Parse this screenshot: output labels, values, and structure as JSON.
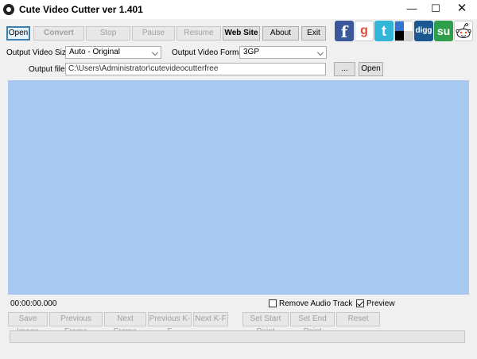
{
  "window": {
    "title": "Cute Video Cutter ver 1.401",
    "minimize_glyph": "—",
    "maximize_glyph": "☐",
    "close_glyph": "✕"
  },
  "toolbar": {
    "open": "Open",
    "convert": "Convert",
    "stop": "Stop",
    "pause": "Pause",
    "resume": "Resume",
    "website": "Web Site",
    "about": "About",
    "exit": "Exit"
  },
  "social": {
    "facebook": "f",
    "google": "g",
    "twitter": "t",
    "digg": "digg",
    "stumbleupon": "su"
  },
  "settings": {
    "video_size_label": "Output Video Size:",
    "video_size_value": "Auto - Original",
    "video_format_label": "Output Video Format:",
    "video_format_value": "3GP",
    "output_file_label": "Output file:",
    "output_file_value": "C:\\Users\\Administrator\\cutevideocutterfree",
    "browse": "...",
    "open_folder": "Open"
  },
  "status": {
    "time": "00:00:00.000",
    "remove_audio_label": "Remove Audio Track",
    "remove_audio_checked": false,
    "preview_label": "Preview",
    "preview_checked": true
  },
  "controls": {
    "save_image": "Save Image",
    "previous_frame": "Previous Frame",
    "next_frame": "Next Frame",
    "previous_kf": "Previous K-F",
    "next_kf": "Next K-F",
    "set_start": "Set  Start Point",
    "set_end": "Set  End Point",
    "reset": "Reset"
  },
  "progress": {
    "value": 0
  },
  "colors": {
    "preview_background": "#a8c9ef",
    "focus_border": "#3c7fb1"
  }
}
